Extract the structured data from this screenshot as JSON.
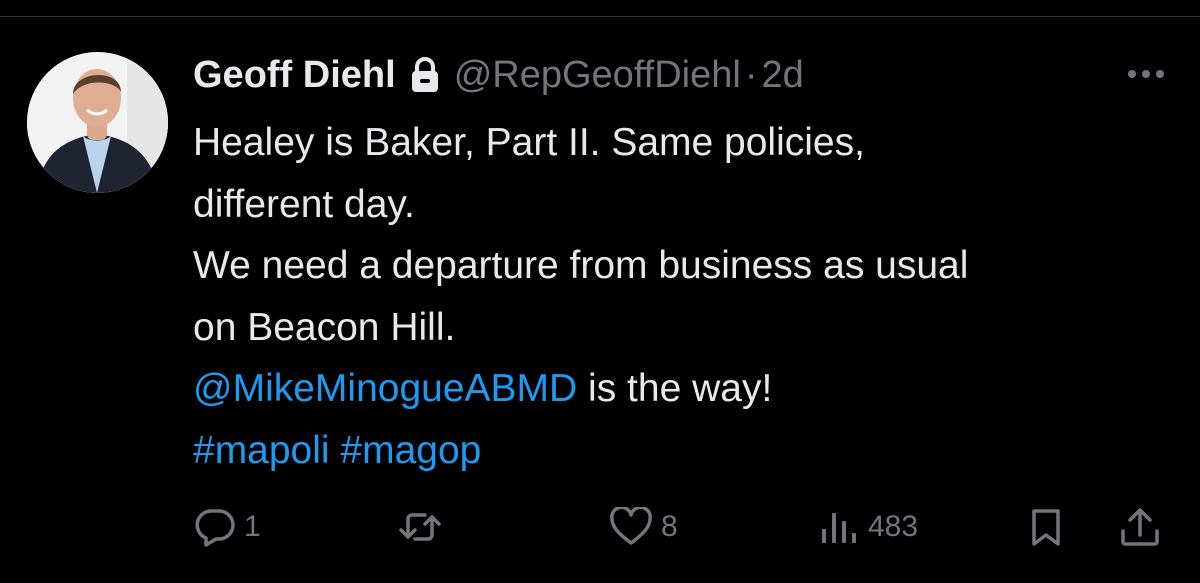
{
  "tweet": {
    "author": {
      "display_name": "Geoff Diehl",
      "handle": "@RepGeoffDiehl",
      "protected_icon": "lock-icon"
    },
    "separator": "·",
    "timestamp": "2d",
    "more_icon": "more-horizontal-icon",
    "text_lines": [
      "Healey is Baker, Part II. Same policies,",
      "different day.",
      "We need a departure from business as usual",
      "on Beacon Hill."
    ],
    "mention": "@MikeMinogueABMD",
    "mention_suffix": " is the way!",
    "hashtags": [
      "#mapoli",
      "#magop"
    ]
  },
  "actions": {
    "reply": {
      "icon": "reply-icon",
      "count": "1"
    },
    "retweet": {
      "icon": "retweet-icon",
      "count": ""
    },
    "like": {
      "icon": "heart-icon",
      "count": "8"
    },
    "views": {
      "icon": "views-icon",
      "count": "483"
    },
    "bookmark": {
      "icon": "bookmark-icon"
    },
    "share": {
      "icon": "share-icon"
    }
  },
  "colors": {
    "background": "#000000",
    "text": "#e7e9ea",
    "secondary": "#71767b",
    "link": "#1d9bf0",
    "divider": "#2f3336"
  }
}
